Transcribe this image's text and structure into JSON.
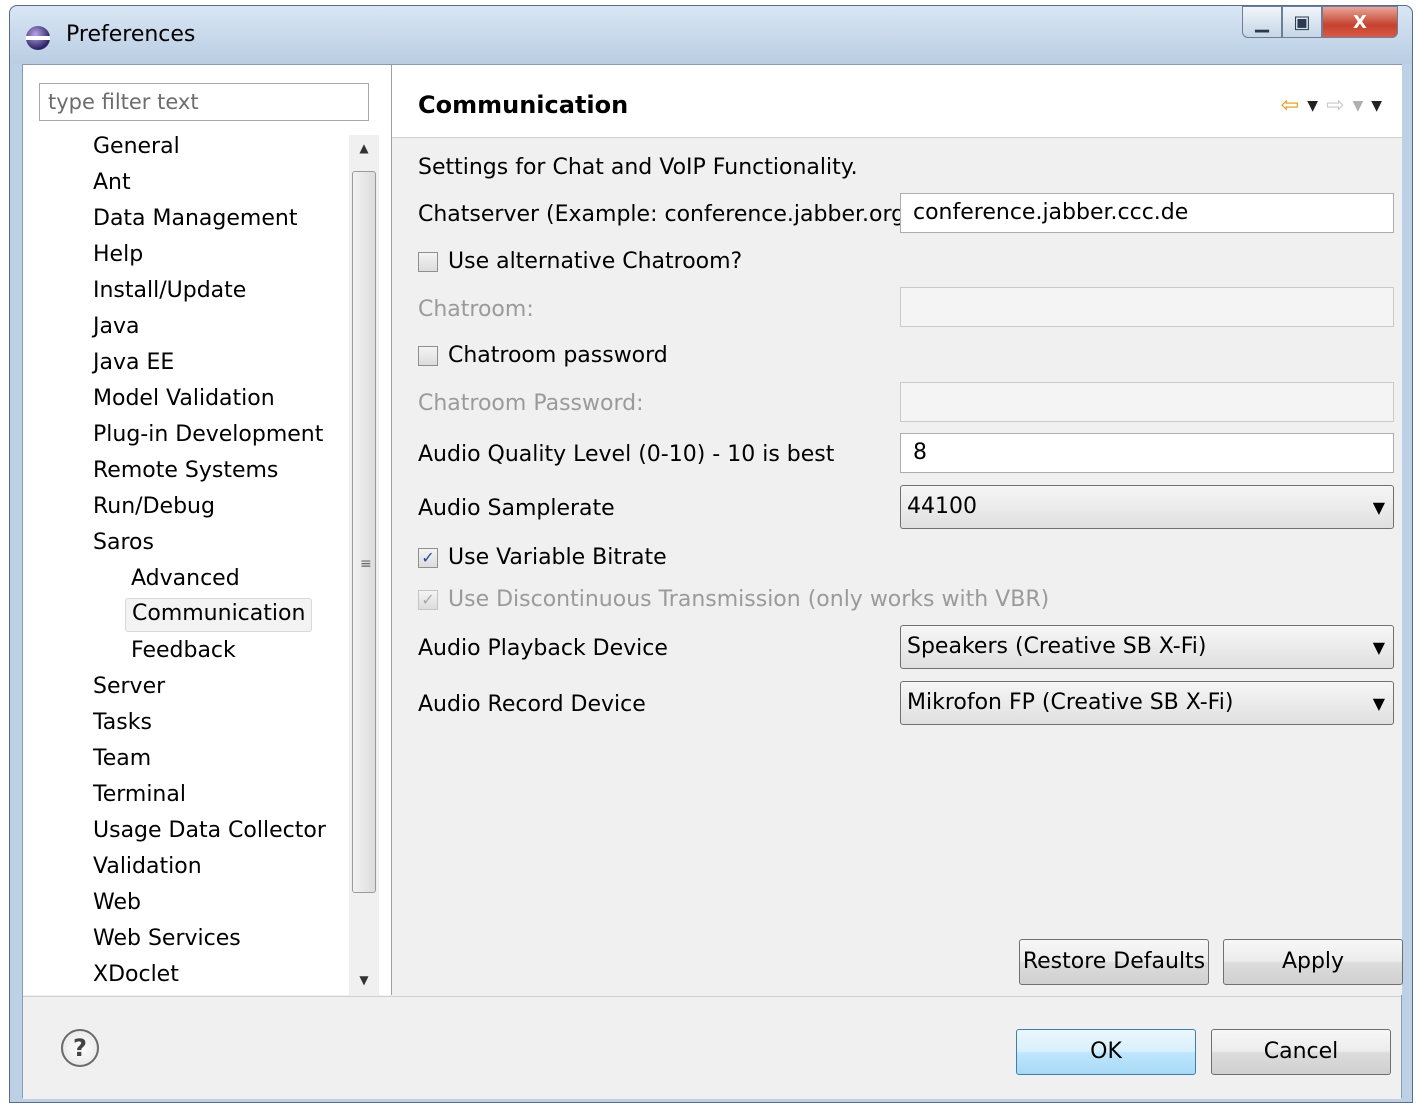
{
  "window": {
    "title": "Preferences"
  },
  "filter": {
    "placeholder": "type filter text"
  },
  "tree": {
    "items": [
      {
        "label": "General"
      },
      {
        "label": "Ant"
      },
      {
        "label": "Data Management"
      },
      {
        "label": "Help"
      },
      {
        "label": "Install/Update"
      },
      {
        "label": "Java"
      },
      {
        "label": "Java EE"
      },
      {
        "label": "Model Validation"
      },
      {
        "label": "Plug-in Development"
      },
      {
        "label": "Remote Systems"
      },
      {
        "label": "Run/Debug"
      },
      {
        "label": "Saros"
      },
      {
        "label": "Advanced"
      },
      {
        "label": "Communication"
      },
      {
        "label": "Feedback"
      },
      {
        "label": "Server"
      },
      {
        "label": "Tasks"
      },
      {
        "label": "Team"
      },
      {
        "label": "Terminal"
      },
      {
        "label": "Usage Data Collector"
      },
      {
        "label": "Validation"
      },
      {
        "label": "Web"
      },
      {
        "label": "Web Services"
      },
      {
        "label": "XDoclet"
      }
    ],
    "selected": "Communication"
  },
  "page": {
    "title": "Communication",
    "description": "Settings for Chat and VoIP Functionality.",
    "chatserver_label": "Chatserver (Example: conference.jabber.org)",
    "chatserver_value": "conference.jabber.ccc.de",
    "alt_chatroom_label": "Use alternative Chatroom?",
    "alt_chatroom_checked": false,
    "chatroom_label": "Chatroom:",
    "chatroom_value": "",
    "chatroom_password_check_label": "Chatroom password",
    "chatroom_password_checked": false,
    "chatroom_password_label": "Chatroom Password:",
    "chatroom_password_value": "",
    "audio_quality_label": "Audio Quality Level (0-10) - 10 is best",
    "audio_quality_value": "8",
    "samplerate_label": "Audio Samplerate",
    "samplerate_value": "44100",
    "vbr_label": "Use Variable Bitrate",
    "vbr_checked": true,
    "dtx_label": "Use Discontinuous Transmission (only works with VBR)",
    "dtx_checked": true,
    "playback_label": "Audio Playback Device",
    "playback_value": "Speakers (Creative SB X-Fi)",
    "record_label": "Audio Record Device",
    "record_value": "Mikrofon FP (Creative SB X-Fi)",
    "restore_defaults": "Restore Defaults",
    "apply": "Apply"
  },
  "footer": {
    "help": "?",
    "ok": "OK",
    "cancel": "Cancel"
  }
}
